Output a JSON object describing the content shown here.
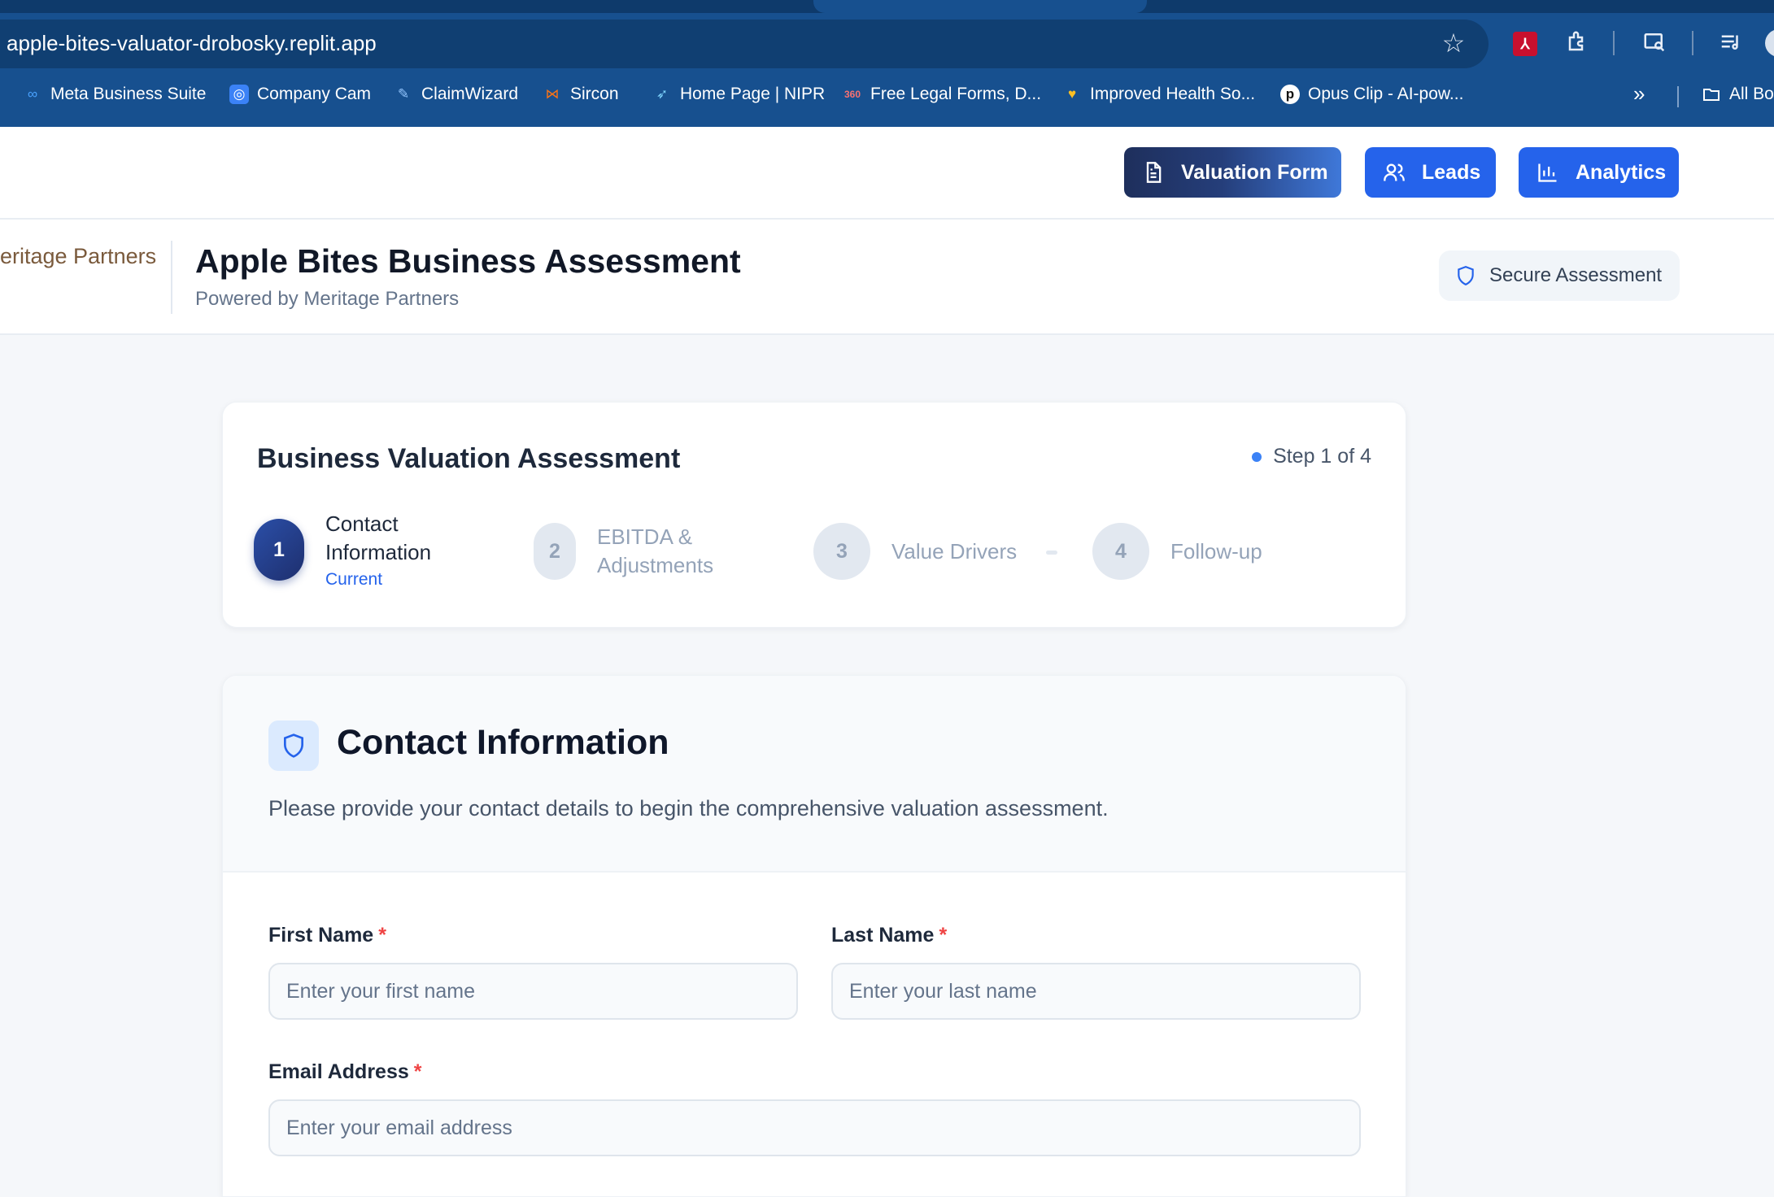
{
  "browser": {
    "url": "apple-bites-valuator-drobosky.replit.app",
    "bookmarks": [
      {
        "label": "Meta Business Suite",
        "icon": "meta-icon",
        "color": "#1877f2"
      },
      {
        "label": "Company Cam",
        "icon": "camera-icon",
        "color": "#3b82f6"
      },
      {
        "label": "ClaimWizard",
        "icon": "wand-icon",
        "color": "#60a5fa"
      },
      {
        "label": "Sircon",
        "icon": "sircon-icon",
        "color": "#f97316"
      },
      {
        "label": "Home Page | NIPR",
        "icon": "nipr-icon",
        "color": "#38bdf8"
      },
      {
        "label": "Free Legal Forms, D...",
        "icon": "legal-forms-icon",
        "color": "#ef4444"
      },
      {
        "label": "Improved Health So...",
        "icon": "heart-icon",
        "color": "#f59e0b"
      },
      {
        "label": "Opus Clip - AI-pow...",
        "icon": "opus-icon",
        "color": "#111111"
      }
    ],
    "all_bookmarks_label": "All Bo"
  },
  "nav": {
    "valuation_form": "Valuation Form",
    "leads": "Leads",
    "analytics": "Analytics"
  },
  "header": {
    "brand_partial": "eritage Partners",
    "title": "Apple Bites Business Assessment",
    "subtitle": "Powered by Meritage Partners",
    "secure_badge": "Secure Assessment"
  },
  "progress": {
    "title": "Business Valuation Assessment",
    "step_counter": "Step 1 of 4",
    "steps": [
      {
        "number": "1",
        "label_line1": "Contact",
        "label_line2": "Information",
        "status": "Current"
      },
      {
        "number": "2",
        "label_line1": "EBITDA &",
        "label_line2": "Adjustments"
      },
      {
        "number": "3",
        "label": "Value Drivers"
      },
      {
        "number": "4",
        "label": "Follow-up"
      }
    ]
  },
  "contact": {
    "title": "Contact Information",
    "description": "Please provide your contact details to begin the comprehensive valuation assessment.",
    "fields": {
      "first_name": {
        "label": "First Name",
        "required": "*",
        "placeholder": "Enter your first name"
      },
      "last_name": {
        "label": "Last Name",
        "required": "*",
        "placeholder": "Enter your last name"
      },
      "email": {
        "label": "Email Address",
        "required": "*",
        "placeholder": "Enter your email address"
      }
    }
  },
  "colors": {
    "chrome": "#17508f",
    "primary": "#2563eb",
    "active_step": "#1e2f6e",
    "required": "#ef4444"
  }
}
